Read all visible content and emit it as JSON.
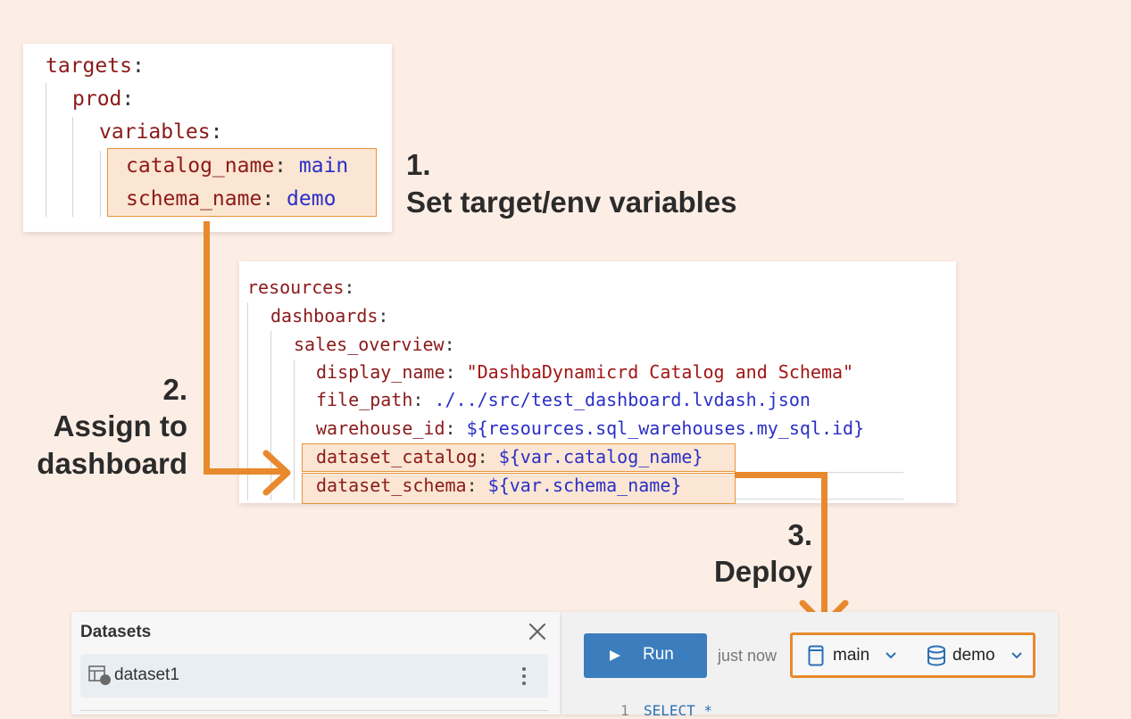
{
  "yaml_targets": {
    "l1_key": "targets",
    "l2_key": "prod",
    "l3_key": "variables",
    "l4_key": "catalog_name",
    "l4_val": "main",
    "l5_key": "schema_name",
    "l5_val": "demo"
  },
  "yaml_resources": {
    "l1_key": "resources",
    "l2_key": "dashboards",
    "l3_key": "sales_overview",
    "l4_key": "display_name",
    "l4_val": "\"DashbaDynamicrd Catalog and Schema\"",
    "l5_key": "file_path",
    "l5_val": "./../src/test_dashboard.lvdash.json",
    "l6_key": "warehouse_id",
    "l6_val": "${resources.sql_warehouses.my_sql.id}",
    "l7_key": "dataset_catalog",
    "l7_val": "${var.catalog_name}",
    "l8_key": "dataset_schema",
    "l8_val": "${var.schema_name}"
  },
  "steps": {
    "s1_num": "1.",
    "s1_text": "Set target/env variables",
    "s2_num": "2.",
    "s2_text_a": "Assign to",
    "s2_text_b": "dashboard",
    "s3_num": "3.",
    "s3_text": "Deploy"
  },
  "datasets_panel": {
    "title": "Datasets",
    "item": "dataset1"
  },
  "query_panel": {
    "run_label": "Run",
    "timestamp": "just now",
    "catalog": "main",
    "schema": "demo",
    "line_no": "1",
    "sql": "SELECT *"
  },
  "colors": {
    "background": "#fdeee5",
    "accent": "#e8892e",
    "run_button": "#3b7dbd",
    "yaml_key": "#8b1a1a",
    "yaml_value": "#2a2fc7"
  }
}
